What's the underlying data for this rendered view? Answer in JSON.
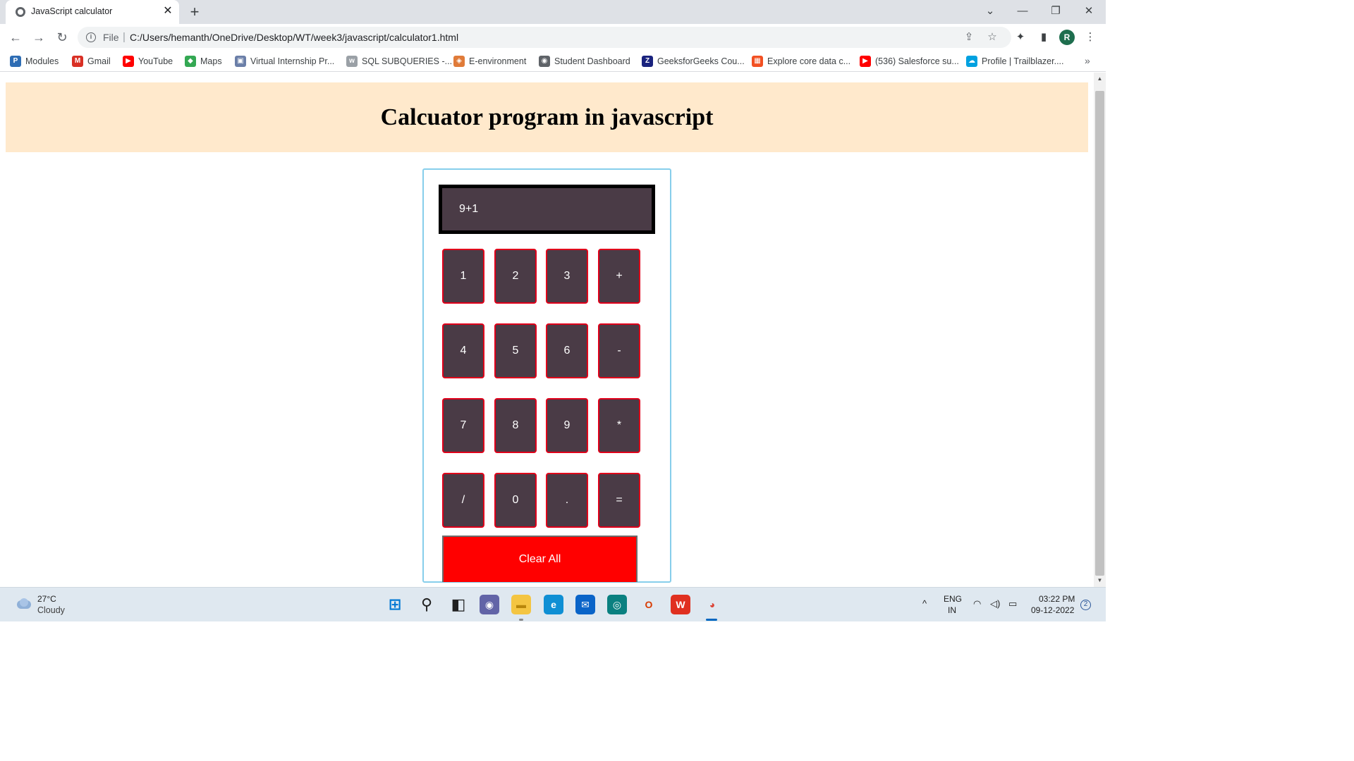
{
  "browser": {
    "tab_title": "JavaScript calculator",
    "tab_close": "✕",
    "new_tab": "+",
    "address_scheme": "File",
    "address_separator": "|",
    "url": "C:/Users/hemanth/OneDrive/Desktop/WT/week3/javascript/calculator1.html",
    "profile_initial": "R",
    "window_controls": {
      "tab_search": "⌄",
      "minimize": "—",
      "restore": "❐",
      "close": "✕"
    },
    "nav": {
      "back": "←",
      "forward": "→",
      "reload": "↻"
    },
    "toolbar_icons": {
      "share": "⇪",
      "star": "☆",
      "extensions": "✦",
      "sidepanel": "▮",
      "menu": "⋮"
    }
  },
  "bookmarks": [
    {
      "label": "Modules",
      "icon": "p-icon",
      "glyph": "P",
      "color": "#2e6db4"
    },
    {
      "label": "Gmail",
      "icon": "gmail-icon",
      "glyph": "M",
      "color": "#d93025"
    },
    {
      "label": "YouTube",
      "icon": "youtube-icon",
      "glyph": "▶",
      "color": "#ff0000"
    },
    {
      "label": "Maps",
      "icon": "maps-icon",
      "glyph": "◆",
      "color": "#34a853"
    },
    {
      "label": "Virtual Internship Pr...",
      "icon": "doc-icon",
      "glyph": "▣",
      "color": "#6b7fa8"
    },
    {
      "label": "SQL SUBQUERIES -...",
      "icon": "w3-icon",
      "glyph": "w",
      "color": "#9aa0a6"
    },
    {
      "label": "E-environment",
      "icon": "shield-icon",
      "glyph": "◈",
      "color": "#e07b39"
    },
    {
      "label": "Student Dashboard",
      "icon": "globe-icon",
      "glyph": "◉",
      "color": "#5f6368"
    },
    {
      "label": "GeeksforGeeks Cou...",
      "icon": "z-icon",
      "glyph": "Z",
      "color": "#1a237e"
    },
    {
      "label": "Explore core data c...",
      "icon": "windows-icon",
      "glyph": "▦",
      "color": "#f25022"
    },
    {
      "label": "(536) Salesforce su...",
      "icon": "youtube-icon",
      "glyph": "▶",
      "color": "#ff0000"
    },
    {
      "label": "Profile | Trailblazer....",
      "icon": "cloud-icon",
      "glyph": "☁",
      "color": "#00a1e0"
    }
  ],
  "bookmarks_overflow": "»",
  "page": {
    "title": "Calcuator program in javascript",
    "display_value": "9+1",
    "keys": [
      [
        "1",
        "2",
        "3",
        "+"
      ],
      [
        "4",
        "5",
        "6",
        "-"
      ],
      [
        "7",
        "8",
        "9",
        "*"
      ],
      [
        "/",
        "0",
        ".",
        "="
      ]
    ],
    "clear_label": "Clear All"
  },
  "taskbar": {
    "weather_temp": "27°C",
    "weather_desc": "Cloudy",
    "apps": [
      {
        "name": "start-icon",
        "glyph": "⊞",
        "bg": "transparent",
        "fg": "#0078d4"
      },
      {
        "name": "search-icon",
        "glyph": "⚲",
        "bg": "transparent",
        "fg": "#202020"
      },
      {
        "name": "task-view-icon",
        "glyph": "◧",
        "bg": "transparent",
        "fg": "#202020"
      },
      {
        "name": "chat-icon",
        "glyph": "◉",
        "bg": "#6264a7",
        "fg": "#ffffff"
      },
      {
        "name": "file-explorer-icon",
        "glyph": "▬",
        "bg": "#f4c542",
        "fg": "#b8860b"
      },
      {
        "name": "edge-icon",
        "glyph": "e",
        "bg": "#0f8fd4",
        "fg": "#ffffff"
      },
      {
        "name": "mail-icon",
        "glyph": "✉",
        "bg": "#0a64c8",
        "fg": "#ffffff"
      },
      {
        "name": "store-icon",
        "glyph": "◎",
        "bg": "#0a8080",
        "fg": "#ffffff"
      },
      {
        "name": "office-icon",
        "glyph": "O",
        "bg": "transparent",
        "fg": "#d83b01"
      },
      {
        "name": "wps-icon",
        "glyph": "W",
        "bg": "#e03020",
        "fg": "#ffffff"
      },
      {
        "name": "chrome-icon",
        "glyph": "◕",
        "bg": "transparent",
        "fg": "#db4437"
      }
    ],
    "tray_chevron": "^",
    "lang_top": "ENG",
    "lang_bottom": "IN",
    "tray_icons": {
      "wifi": "◠",
      "volume": "◁)",
      "battery": "▭"
    },
    "time": "03:22 PM",
    "date": "09-12-2022",
    "notification_count": "2"
  }
}
